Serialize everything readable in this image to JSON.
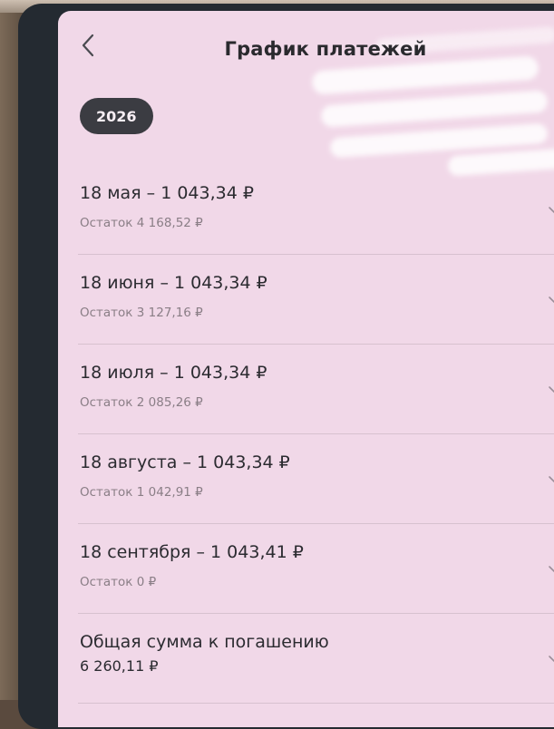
{
  "header": {
    "title": "График платежей"
  },
  "year_chip": "2026",
  "payments": [
    {
      "title": "18 мая – 1 043,34 ₽",
      "remaining": "Остаток 4 168,52 ₽"
    },
    {
      "title": "18 июня – 1 043,34 ₽",
      "remaining": "Остаток 3 127,16 ₽"
    },
    {
      "title": "18 июля – 1 043,34 ₽",
      "remaining": "Остаток 2 085,26 ₽"
    },
    {
      "title": "18 августа – 1 043,34 ₽",
      "remaining": "Остаток 1 042,91 ₽"
    },
    {
      "title": "18 сентября – 1 043,41 ₽",
      "remaining": "Остаток 0 ₽"
    }
  ],
  "total": {
    "label": "Общая сумма к погашению",
    "value": "6 260,11 ₽"
  },
  "icons": {
    "back": "chevron-left-icon",
    "expand": "chevron-down-icon"
  },
  "colors": {
    "screen_bg": "#f1d8e8",
    "chip_bg": "#3b3c42",
    "text_primary": "#2b2b30",
    "text_secondary": "#8a7e86"
  }
}
